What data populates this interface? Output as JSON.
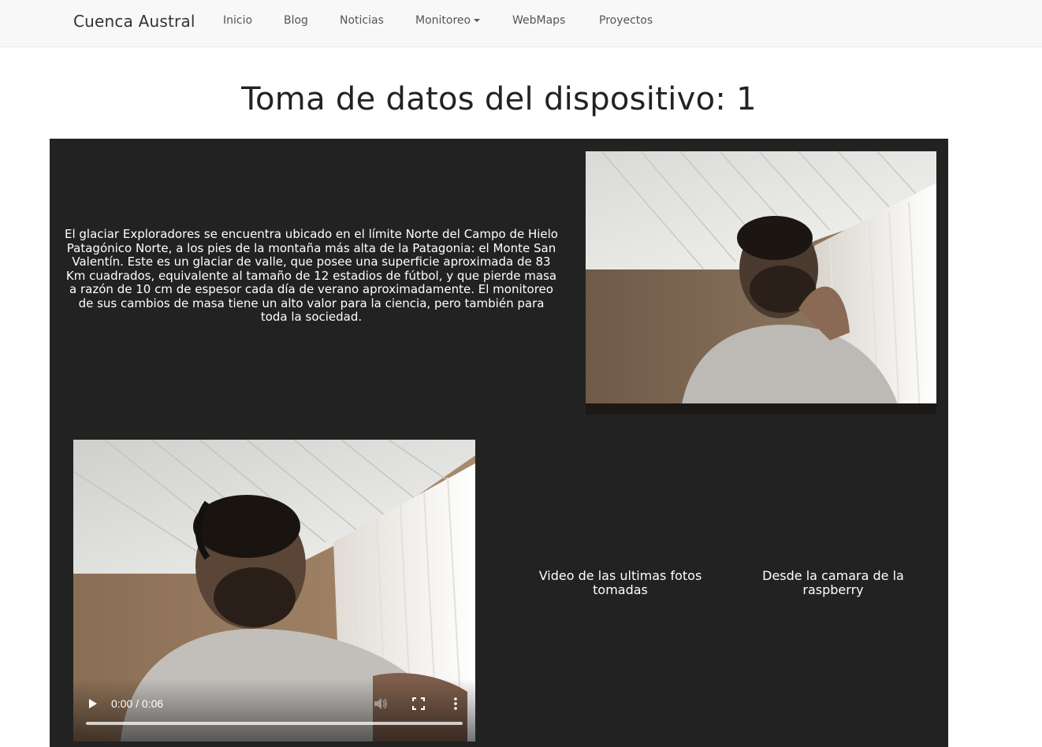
{
  "navbar": {
    "brand": "Cuenca Austral",
    "items": [
      {
        "label": "Inicio"
      },
      {
        "label": "Blog"
      },
      {
        "label": "Noticias"
      },
      {
        "label": "Monitoreo"
      },
      {
        "label": "WebMaps"
      },
      {
        "label": "Proyectos"
      }
    ]
  },
  "page": {
    "title": "Toma de datos del dispositivo: 1"
  },
  "main": {
    "description": "El glaciar Exploradores se encuentra ubicado en el límite Norte del Campo de Hielo Patagónico Norte, a los pies de la montaña más alta de la Patagonia: el Monte San Valentín. Este es un glaciar de valle, que posee una superficie aproximada de 83 Km cuadrados, equivalente al tamaño de 12 estadios de fútbol, y que pierde masa a razón de 10 cm de espesor cada día de verano aproximadamente. El monitoreo de sus cambios de masa tiene un alto valor para la ciencia, pero también para toda la sociedad.",
    "video": {
      "time": "0:00 / 0:06",
      "progress": 0
    },
    "caption_video": "Video de las ultimas fotos tomadas",
    "caption_camera": "Desde la camara de la raspberry"
  },
  "colors": {
    "panel": "#222222",
    "navbar": "#f8f8f8"
  }
}
